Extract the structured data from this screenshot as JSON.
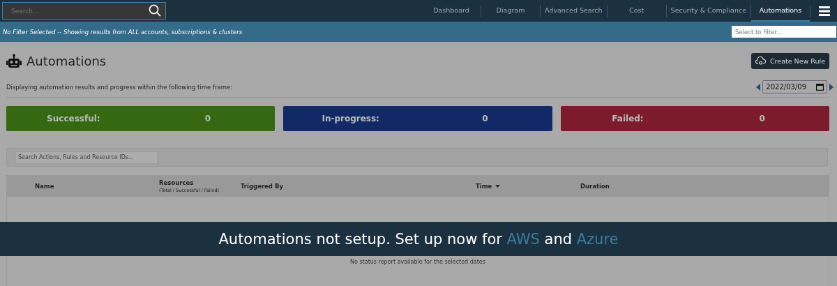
{
  "search": {
    "placeholder": "Search..."
  },
  "nav": [
    {
      "label": "Dashboard",
      "selected": false
    },
    {
      "label": "Diagram",
      "selected": false
    },
    {
      "label": "Advanced Search",
      "selected": false
    },
    {
      "label": "Cost",
      "selected": false
    },
    {
      "label": "Security & Compliance",
      "selected": false
    },
    {
      "label": "Automations",
      "selected": true
    }
  ],
  "filter_bar": {
    "message": "No Filter Selected -- Showing results from ALL accounts, subscriptions & clusters",
    "placeholder": "Select to filter..."
  },
  "page": {
    "title": "Automations",
    "button": "Create New Rule",
    "description": "Displaying automation results and progress within the following time frame:",
    "date": "2022/03/09"
  },
  "stats": [
    {
      "label": "Successful:",
      "value": "0",
      "color": "#346912"
    },
    {
      "label": "In-progress:",
      "value": "0",
      "color": "#112967"
    },
    {
      "label": "Failed:",
      "value": "0",
      "color": "#7c1b2b"
    }
  ],
  "table_search": {
    "placeholder": "Search Actions, Rules and Resource IDs..."
  },
  "table": {
    "columns": [
      {
        "label": "Name"
      },
      {
        "label": "Resources",
        "sub": "(Total / Successful / Failed)"
      },
      {
        "label": "Triggered By"
      },
      {
        "label": "Time"
      },
      {
        "label": "Duration"
      }
    ],
    "empty": "No status report available for the selected dates"
  },
  "banner": {
    "text_before": "Automations not setup. Set up now for",
    "link_1": "AWS",
    "text_middle": "and",
    "link_2": "Azure"
  }
}
